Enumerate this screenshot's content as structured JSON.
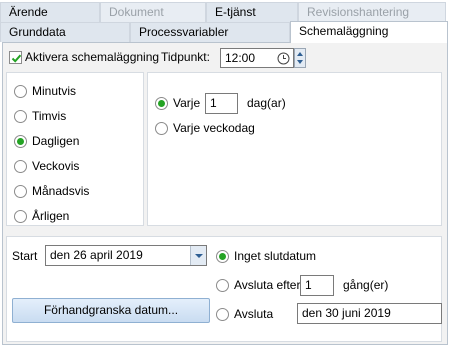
{
  "tabs_row1": [
    "Ärende",
    "Dokument",
    "E-tjänst",
    "Revisionshantering"
  ],
  "tabs_row2": [
    "Grunddata",
    "Processvariabler",
    "Schemaläggning"
  ],
  "scheduling": {
    "enable_label": "Aktivera schemaläggning",
    "enabled": true,
    "time_label": "Tidpunkt:",
    "time_value": "12:00"
  },
  "frequency": {
    "options": [
      "Minutvis",
      "Timvis",
      "Dagligen",
      "Veckovis",
      "Månadsvis",
      "Årligen"
    ],
    "selected": "Dagligen"
  },
  "daily": {
    "every_label": "Varje",
    "every_value": "1",
    "unit_label": "dag(ar)",
    "weekday_label": "Varje veckodag",
    "selected": "every"
  },
  "range": {
    "start_label": "Start",
    "start_value": "den 26 april 2019",
    "no_end_label": "Inget slutdatum",
    "end_after_label": "Avsluta efter",
    "end_after_value": "1",
    "times_label": "gång(er)",
    "end_by_label": "Avsluta",
    "end_by_value": "den 30 juni 2019",
    "selected": "no_end"
  },
  "preview_button": "Förhandgranska datum...",
  "colors": {
    "accent_green": "#24a324",
    "tab_bg": "#dfe6ee",
    "button_blue": "#c9dcf1"
  }
}
